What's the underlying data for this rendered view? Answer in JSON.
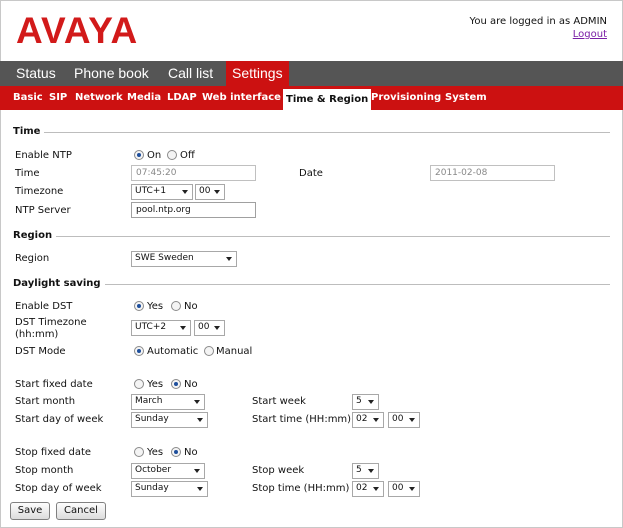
{
  "header": {
    "logo": "AVAYA",
    "logged_in_text": "You are logged in as ADMIN",
    "logout": "Logout"
  },
  "main_tabs": [
    "Status",
    "Phone book",
    "Call list",
    "Settings"
  ],
  "sub_tabs": [
    "Basic",
    "SIP",
    "Network",
    "Media",
    "LDAP",
    "Web interface",
    "Time & Region",
    "Provisioning",
    "System"
  ],
  "time": {
    "heading": "Time",
    "enable_ntp_label": "Enable NTP",
    "on": "On",
    "off": "Off",
    "time_label": "Time",
    "time_value": "07:45:20",
    "date_label": "Date",
    "date_value": "2011-02-08",
    "timezone_label": "Timezone",
    "timezone_value": "UTC+1",
    "timezone_minutes": "00",
    "ntp_server_label": "NTP Server",
    "ntp_server_value": "pool.ntp.org"
  },
  "region": {
    "heading": "Region",
    "region_label": "Region",
    "region_value": "SWE Sweden"
  },
  "dst": {
    "heading": "Daylight saving",
    "enable_label": "Enable DST",
    "yes": "Yes",
    "no": "No",
    "timezone_label_1": "DST Timezone",
    "timezone_label_2": "(hh:mm)",
    "timezone_value": "UTC+2",
    "timezone_minutes": "00",
    "mode_label": "DST Mode",
    "automatic": "Automatic",
    "manual": "Manual",
    "start_fixed_label": "Start fixed date",
    "start_month_label": "Start month",
    "start_month_value": "March",
    "start_week_label": "Start week",
    "start_week_value": "5",
    "start_dow_label": "Start day of week",
    "start_dow_value": "Sunday",
    "start_time_label": "Start time (HH:mm)",
    "start_time_hh": "02",
    "start_time_mm": "00",
    "stop_fixed_label": "Stop fixed date",
    "stop_month_label": "Stop month",
    "stop_month_value": "October",
    "stop_week_label": "Stop week",
    "stop_week_value": "5",
    "stop_dow_label": "Stop day of week",
    "stop_dow_value": "Sunday",
    "stop_time_label": "Stop time (HH:mm)",
    "stop_time_hh": "02",
    "stop_time_mm": "00"
  },
  "buttons": {
    "save": "Save",
    "cancel": "Cancel"
  },
  "colors": {
    "brand_red": "#cc1111",
    "nav_gray": "#555555"
  }
}
